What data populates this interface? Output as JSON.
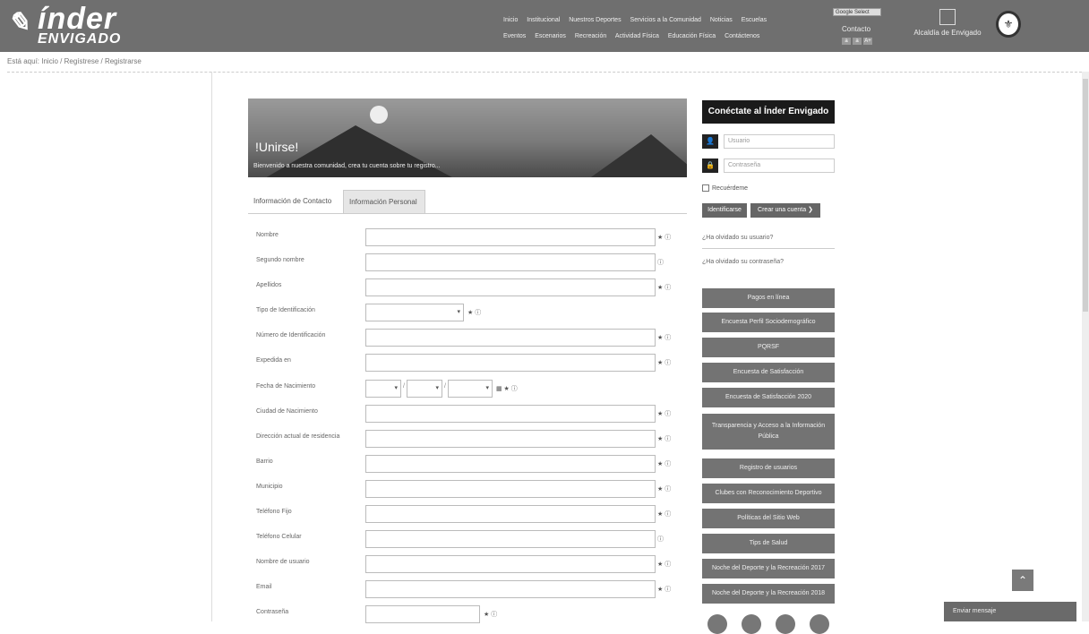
{
  "logo": {
    "name": "índer",
    "sub": "ENVIGADO"
  },
  "nav": {
    "row1": [
      "Inicio",
      "Institucional",
      "Nuestros Deportes",
      "Servicios a la Comunidad",
      "Noticias",
      "Escuelas"
    ],
    "row2": [
      "Eventos",
      "Escenarios",
      "Recreación",
      "Actividad Física",
      "Educación Física",
      "Contáctenos"
    ]
  },
  "lang_select": "Google Select",
  "contact": "Contacto",
  "font_buttons": [
    "a",
    "a",
    "A+"
  ],
  "alcaldia": "Alcaldía de Envigado",
  "breadcrumb": "Está aquí: Inicio / Regístrese / Registrarse",
  "banner": {
    "title": "!Unirse!",
    "desc": "Bienvenido a nuestra comunidad, crea tu cuenta sobre tu registro..."
  },
  "tabs": [
    "Información de Contacto",
    "Información Personal"
  ],
  "form": {
    "nombre": "Nombre",
    "segundo_nombre": "Segundo nombre",
    "apellidos": "Apellidos",
    "tipo_id": "Tipo de Identificación",
    "numero_id": "Número de Identificación",
    "expedida": "Expedida en",
    "fecha_nac": "Fecha de Nacimiento",
    "ciudad_nac": "Ciudad de Nacimiento",
    "direccion": "Dirección actual de residencia",
    "barrio": "Barrio",
    "municipio": "Municipio",
    "tel_fijo": "Teléfono Fijo",
    "tel_celular": "Teléfono Celular",
    "usuario": "Nombre de usuario",
    "email": "Email",
    "contrasena": "Contraseña",
    "required_icons": "★ ⓘ",
    "info_icon": "ⓘ",
    "date_icons": "▦ ★ ⓘ"
  },
  "sidebar": {
    "title": "Conéctate al Índer Envigado",
    "user_placeholder": "Usuario",
    "pass_placeholder": "Contraseña",
    "remember": "Recuérdeme",
    "login_btn": "Identificarse",
    "register_btn": "Crear una cuenta ❯",
    "forgot_user": "¿Ha olvidado su usuario?",
    "forgot_pass": "¿Ha olvidado su contraseña?",
    "menu": [
      "Pagos en línea",
      "Encuesta Perfil Sociodemográfico",
      "PQRSF",
      "Encuesta de Satisfacción",
      "Encuesta de Satisfacción 2020",
      "Transparencia y Acceso a la Información Pública",
      "Registro de usuarios",
      "Clubes con Reconocimiento Deportivo",
      "Políticas del Sitio Web",
      "Tips de Salud",
      "Noche del Deporte y la Recreación 2017",
      "Noche del Deporte y la Recreación 2018"
    ]
  },
  "chat": "Enviar mensaje",
  "colors": {
    "header": "#6f6f6f",
    "dark": "#1a1a1a",
    "menu": "#737373"
  }
}
